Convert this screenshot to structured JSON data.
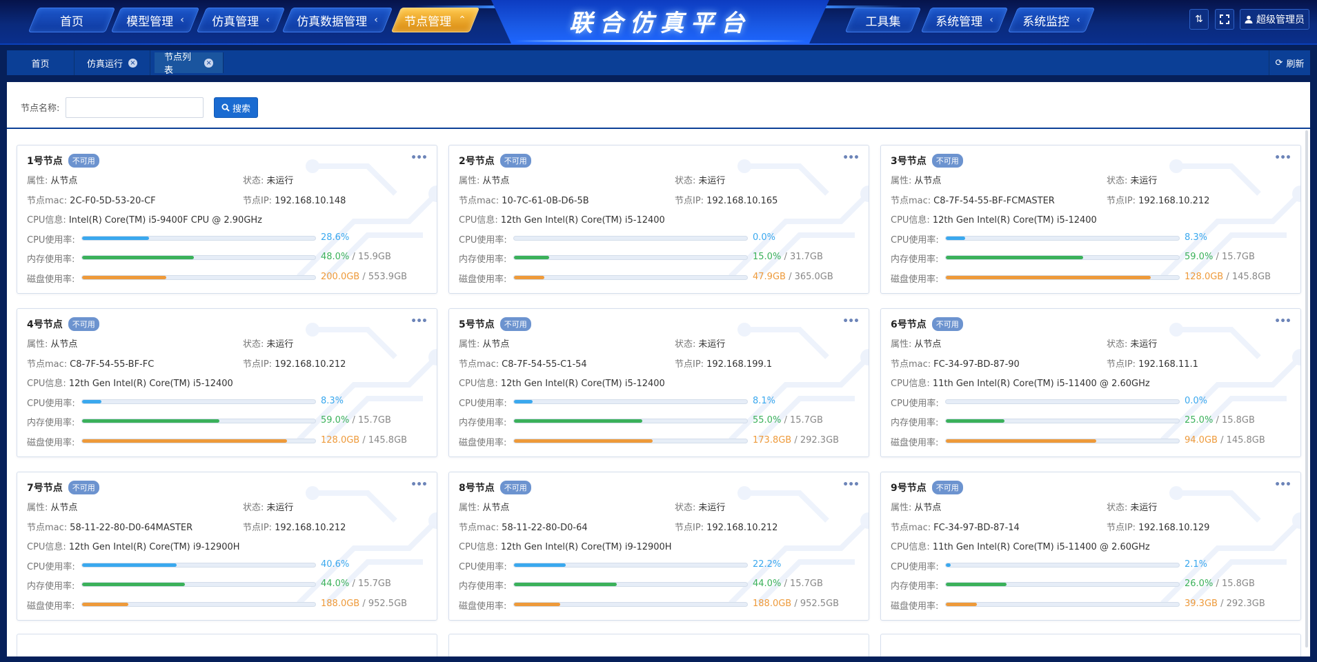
{
  "app": {
    "title": "联合仿真平台",
    "nav_left": [
      {
        "label": "首页",
        "chevron": "",
        "active": false
      },
      {
        "label": "模型管理",
        "chevron": "‹",
        "active": false
      },
      {
        "label": "仿真管理",
        "chevron": "‹",
        "active": false
      },
      {
        "label": "仿真数据管理",
        "chevron": "‹",
        "active": false
      },
      {
        "label": "节点管理",
        "chevron": "⌃",
        "active": true
      }
    ],
    "nav_right": [
      {
        "label": "工具集",
        "chevron": ""
      },
      {
        "label": "系统管理",
        "chevron": "‹"
      },
      {
        "label": "系统监控",
        "chevron": "‹"
      }
    ],
    "user": "超级管理员"
  },
  "tabs": {
    "items": [
      {
        "label": "首页",
        "closable": false
      },
      {
        "label": "仿真运行",
        "closable": true
      },
      {
        "label": "节点列表",
        "closable": true,
        "active": true
      }
    ],
    "refresh": "刷新"
  },
  "search": {
    "label": "节点名称:",
    "value": "",
    "placeholder": "",
    "button": "搜索"
  },
  "labels": {
    "attr": "属性:",
    "status": "状态:",
    "mac": "节点mac:",
    "ip": "节点IP:",
    "cpu_info": "CPU信息:",
    "cpu_usage": "CPU使用率:",
    "mem_usage": "内存使用率:",
    "disk_usage": "磁盘使用率:"
  },
  "colors": {
    "cpu": "#3aa8ee",
    "mem": "#3bb15a",
    "disk": "#ee9a3a",
    "badge": "#6c93cf",
    "accent": "#1a6bd1"
  },
  "nodes": [
    {
      "name": "1号节点",
      "badge": "不可用",
      "attr": "从节点",
      "status": "未运行",
      "mac": "2C-F0-5D-53-20-CF",
      "ip": "192.168.10.148",
      "cpu_info": "Intel(R) Core(TM) i5-9400F CPU @ 2.90GHz",
      "cpu_pct": 28.6,
      "cpu_text": "28.6%",
      "mem_pct": 48.0,
      "mem_text": "48.0%",
      "mem_total": " / 15.9GB",
      "disk_pct": 36.1,
      "disk_text": "200.0GB",
      "disk_total": " / 553.9GB"
    },
    {
      "name": "2号节点",
      "badge": "不可用",
      "attr": "从节点",
      "status": "未运行",
      "mac": "10-7C-61-0B-D6-5B",
      "ip": "192.168.10.165",
      "cpu_info": "12th Gen Intel(R) Core(TM) i5-12400",
      "cpu_pct": 0.0,
      "cpu_text": "0.0%",
      "mem_pct": 15.0,
      "mem_text": "15.0%",
      "mem_total": " / 31.7GB",
      "disk_pct": 13.1,
      "disk_text": "47.9GB",
      "disk_total": " / 365.0GB"
    },
    {
      "name": "3号节点",
      "badge": "不可用",
      "attr": "从节点",
      "status": "未运行",
      "mac": "C8-7F-54-55-BF-FCMASTER",
      "ip": "192.168.10.212",
      "cpu_info": "12th Gen Intel(R) Core(TM) i5-12400",
      "cpu_pct": 8.3,
      "cpu_text": "8.3%",
      "mem_pct": 59.0,
      "mem_text": "59.0%",
      "mem_total": " / 15.7GB",
      "disk_pct": 87.8,
      "disk_text": "128.0GB",
      "disk_total": " / 145.8GB"
    },
    {
      "name": "4号节点",
      "badge": "不可用",
      "attr": "从节点",
      "status": "未运行",
      "mac": "C8-7F-54-55-BF-FC",
      "ip": "192.168.10.212",
      "cpu_info": "12th Gen Intel(R) Core(TM) i5-12400",
      "cpu_pct": 8.3,
      "cpu_text": "8.3%",
      "mem_pct": 59.0,
      "mem_text": "59.0%",
      "mem_total": " / 15.7GB",
      "disk_pct": 87.8,
      "disk_text": "128.0GB",
      "disk_total": " / 145.8GB"
    },
    {
      "name": "5号节点",
      "badge": "不可用",
      "attr": "从节点",
      "status": "未运行",
      "mac": "C8-7F-54-55-C1-54",
      "ip": "192.168.199.1",
      "cpu_info": "12th Gen Intel(R) Core(TM) i5-12400",
      "cpu_pct": 8.1,
      "cpu_text": "8.1%",
      "mem_pct": 55.0,
      "mem_text": "55.0%",
      "mem_total": " / 15.7GB",
      "disk_pct": 59.4,
      "disk_text": "173.8GB",
      "disk_total": " / 292.3GB"
    },
    {
      "name": "6号节点",
      "badge": "不可用",
      "attr": "从节点",
      "status": "未运行",
      "mac": "FC-34-97-BD-87-90",
      "ip": "192.168.11.1",
      "cpu_info": "11th Gen Intel(R) Core(TM) i5-11400 @ 2.60GHz",
      "cpu_pct": 0.0,
      "cpu_text": "0.0%",
      "mem_pct": 25.0,
      "mem_text": "25.0%",
      "mem_total": " / 15.8GB",
      "disk_pct": 64.5,
      "disk_text": "94.0GB",
      "disk_total": " / 145.8GB"
    },
    {
      "name": "7号节点",
      "badge": "不可用",
      "attr": "从节点",
      "status": "未运行",
      "mac": "58-11-22-80-D0-64MASTER",
      "ip": "192.168.10.212",
      "cpu_info": "12th Gen Intel(R) Core(TM) i9-12900H",
      "cpu_pct": 40.6,
      "cpu_text": "40.6%",
      "mem_pct": 44.0,
      "mem_text": "44.0%",
      "mem_total": " / 15.7GB",
      "disk_pct": 19.7,
      "disk_text": "188.0GB",
      "disk_total": " / 952.5GB"
    },
    {
      "name": "8号节点",
      "badge": "不可用",
      "attr": "从节点",
      "status": "未运行",
      "mac": "58-11-22-80-D0-64",
      "ip": "192.168.10.212",
      "cpu_info": "12th Gen Intel(R) Core(TM) i9-12900H",
      "cpu_pct": 22.2,
      "cpu_text": "22.2%",
      "mem_pct": 44.0,
      "mem_text": "44.0%",
      "mem_total": " / 15.7GB",
      "disk_pct": 19.7,
      "disk_text": "188.0GB",
      "disk_total": " / 952.5GB"
    },
    {
      "name": "9号节点",
      "badge": "不可用",
      "attr": "从节点",
      "status": "未运行",
      "mac": "FC-34-97-BD-87-14",
      "ip": "192.168.10.129",
      "cpu_info": "11th Gen Intel(R) Core(TM) i5-11400 @ 2.60GHz",
      "cpu_pct": 2.1,
      "cpu_text": "2.1%",
      "mem_pct": 26.0,
      "mem_text": "26.0%",
      "mem_total": " / 15.8GB",
      "disk_pct": 13.4,
      "disk_text": "39.3GB",
      "disk_total": " / 292.3GB"
    }
  ]
}
